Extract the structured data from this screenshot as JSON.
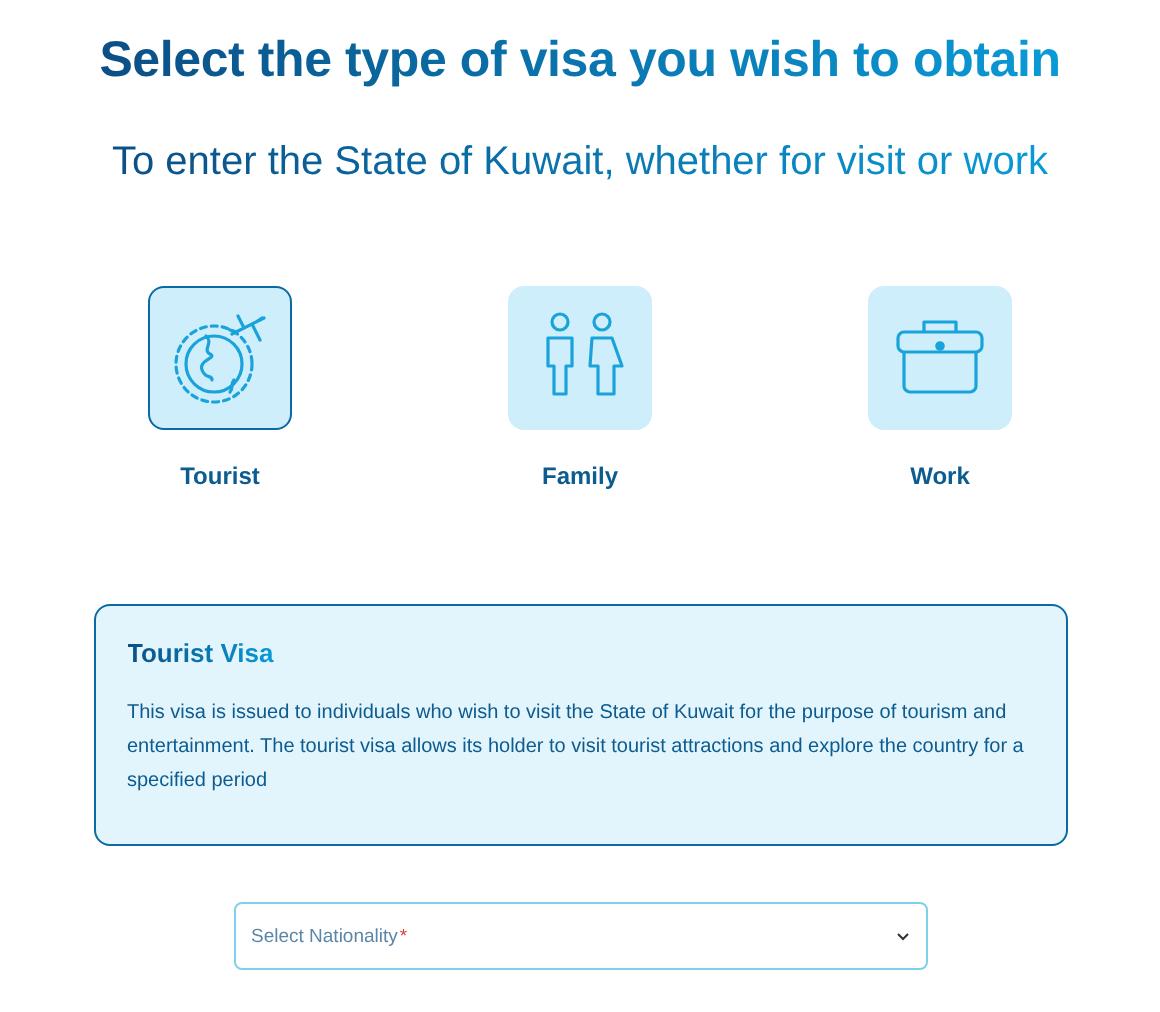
{
  "heading": "Select the type of visa you wish to obtain",
  "subheading": "To enter the State of Kuwait, whether for visit or work",
  "visa_types": [
    {
      "kind": "tourist",
      "label": "Tourist",
      "selected": true
    },
    {
      "kind": "family",
      "label": "Family",
      "selected": false
    },
    {
      "kind": "work",
      "label": "Work",
      "selected": false
    }
  ],
  "info_card": {
    "title": "Tourist Visa",
    "description": "This visa is issued to individuals who wish to visit the State of Kuwait for the purpose of tourism and entertainment. The tourist visa allows its holder to visit tourist attractions and explore the country for a specified period"
  },
  "nationality_select": {
    "placeholder": "Select Nationality",
    "required_mark": "*"
  }
}
